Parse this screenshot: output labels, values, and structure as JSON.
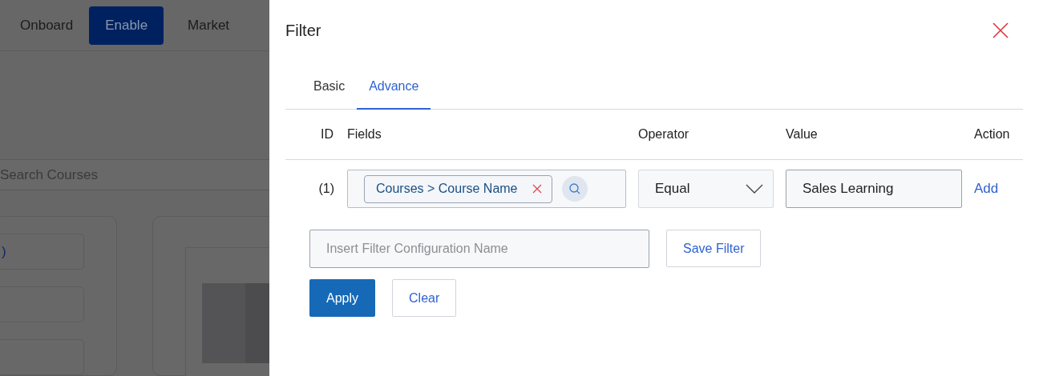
{
  "background": {
    "nav": [
      {
        "label": "Onboard",
        "selected": false
      },
      {
        "label": "Enable",
        "selected": true
      },
      {
        "label": "Market",
        "selected": false
      }
    ],
    "search": {
      "placeholder": "Search Courses"
    },
    "card_text": ")"
  },
  "filter": {
    "title": "Filter",
    "tabs": [
      {
        "label": "Basic",
        "selected": false
      },
      {
        "label": "Advance",
        "selected": true
      }
    ],
    "columns": [
      "ID",
      "Fields",
      "Operator",
      "Value",
      "Action"
    ],
    "rows": [
      {
        "id": "(1)",
        "field_chip": "Courses > Course Name",
        "operator": "Equal",
        "value": "Sales Learning",
        "action": "Add"
      }
    ],
    "config_name": {
      "placeholder": "Insert Filter Configuration Name"
    },
    "save_button": "Save Filter",
    "apply_button": "Apply",
    "clear_button": "Clear"
  }
}
